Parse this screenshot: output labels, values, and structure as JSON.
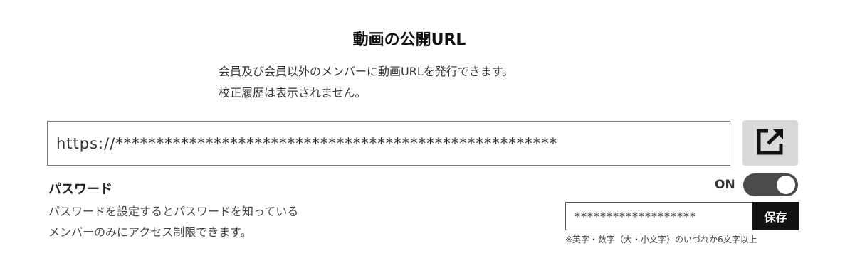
{
  "header": {
    "title": "動画の公開URL",
    "description_line1": "会員及び会員以外のメンバーに動画URLを発行できます。",
    "description_line2": "校正履歴は表示されません。"
  },
  "url_field": {
    "value": "https://******************************************************"
  },
  "open_button": {
    "icon": "external-link-icon"
  },
  "password": {
    "heading": "パスワード",
    "description_line1": "パスワードを設定するとパスワードを知っている",
    "description_line2": "メンバーのみにアクセス制限できます。",
    "toggle_label": "ON",
    "toggle_on": true,
    "value": "*******************",
    "save_label": "保存",
    "hint": "※英字・数字（大・小文字）のいづれか6文字以上"
  },
  "colors": {
    "accent_dark": "#111111",
    "toggle_bg": "#4a4a4a",
    "button_gray": "#d9d9d9"
  }
}
